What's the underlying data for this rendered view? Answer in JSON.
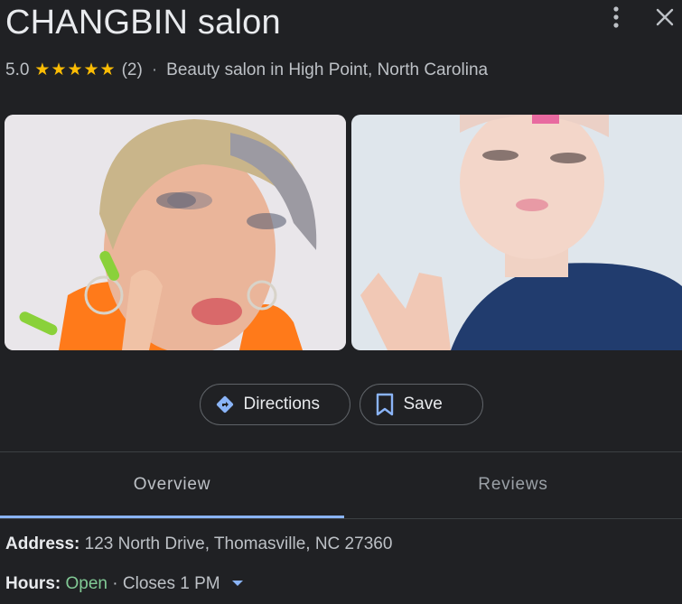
{
  "header": {
    "title": "CHANGBIN salon",
    "more_icon": "more-vert-icon",
    "close_icon": "close-icon"
  },
  "summary": {
    "rating": "5.0",
    "stars": "★★★★★",
    "review_count": "(2)",
    "separator": "·",
    "category": "Beauty salon in High Point, North Carolina",
    "star_color": "#fbbc04"
  },
  "photos": [
    {
      "name": "salon-photo-1"
    },
    {
      "name": "salon-photo-2"
    }
  ],
  "actions": {
    "directions_label": "Directions",
    "save_label": "Save",
    "directions_icon": "directions-icon",
    "save_icon": "bookmark-icon"
  },
  "tabs": [
    {
      "label": "Overview",
      "active": true
    },
    {
      "label": "Reviews",
      "active": false
    }
  ],
  "details": {
    "address_label": "Address:",
    "address_value": "123 North Drive, Thomasville, NC 27360",
    "hours_label": "Hours:",
    "hours_status": "Open",
    "hours_separator": "·",
    "hours_close": "Closes 1 PM",
    "open_color": "#81c995",
    "accent_color": "#8ab4f8"
  }
}
